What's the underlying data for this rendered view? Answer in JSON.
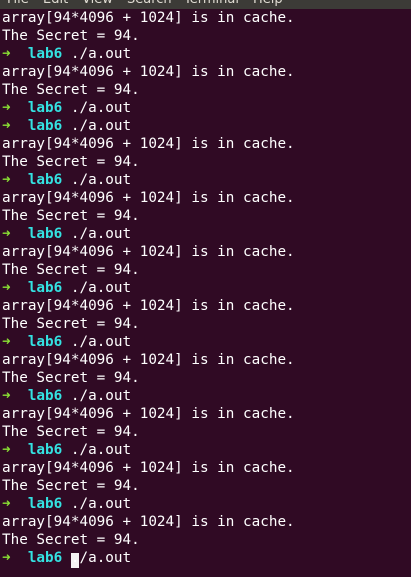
{
  "menu": [
    "File",
    "Edit",
    "View",
    "Search",
    "Terminal",
    "Help"
  ],
  "prompt": {
    "arrow": "➜",
    "dir": "lab6",
    "command": "./a.out"
  },
  "output": {
    "cache_line": "array[94*4096 + 1024] is in cache.",
    "secret_line": "The Secret = 94."
  },
  "lines": [
    {
      "type": "cache"
    },
    {
      "type": "secret"
    },
    {
      "type": "prompt"
    },
    {
      "type": "cache"
    },
    {
      "type": "secret"
    },
    {
      "type": "prompt"
    },
    {
      "type": "prompt"
    },
    {
      "type": "cache"
    },
    {
      "type": "secret"
    },
    {
      "type": "prompt"
    },
    {
      "type": "cache"
    },
    {
      "type": "secret"
    },
    {
      "type": "prompt"
    },
    {
      "type": "cache"
    },
    {
      "type": "secret"
    },
    {
      "type": "prompt"
    },
    {
      "type": "cache"
    },
    {
      "type": "secret"
    },
    {
      "type": "prompt"
    },
    {
      "type": "cache"
    },
    {
      "type": "secret"
    },
    {
      "type": "prompt"
    },
    {
      "type": "cache"
    },
    {
      "type": "secret"
    },
    {
      "type": "prompt"
    },
    {
      "type": "cache"
    },
    {
      "type": "secret"
    },
    {
      "type": "prompt"
    },
    {
      "type": "cache"
    },
    {
      "type": "secret"
    },
    {
      "type": "prompt",
      "cursor": true
    }
  ],
  "colors": {
    "background": "#300a24",
    "text": "#ffffff",
    "arrow": "#8ae234",
    "dir": "#34e2e2",
    "menubar": "#3c3b37"
  }
}
